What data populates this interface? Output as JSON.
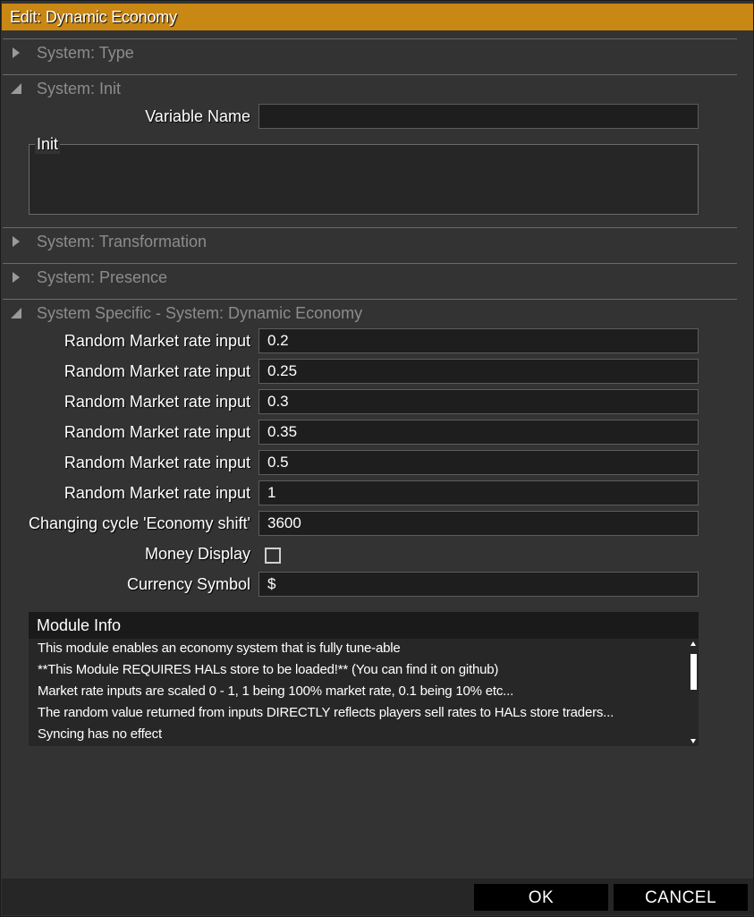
{
  "window": {
    "title": "Edit: Dynamic Economy"
  },
  "sections": {
    "type": {
      "label": "System: Type",
      "expanded": false
    },
    "init": {
      "label": "System: Init",
      "expanded": true
    },
    "transformation": {
      "label": "System: Transformation",
      "expanded": false
    },
    "presence": {
      "label": "System: Presence",
      "expanded": false
    },
    "specific": {
      "label": "System Specific - System: Dynamic Economy",
      "expanded": true
    }
  },
  "init": {
    "variable_name_label": "Variable Name",
    "variable_name_value": "",
    "init_label": "Init",
    "init_value": ""
  },
  "economy": {
    "rates": [
      {
        "label": "Random Market rate input",
        "value": "0.2"
      },
      {
        "label": "Random Market rate input",
        "value": "0.25"
      },
      {
        "label": "Random Market rate input",
        "value": "0.3"
      },
      {
        "label": "Random Market rate input",
        "value": "0.35"
      },
      {
        "label": "Random Market rate input",
        "value": "0.5"
      },
      {
        "label": "Random Market rate input",
        "value": "1"
      }
    ],
    "cycle_label": "Changing cycle 'Economy shift'",
    "cycle_value": "3600",
    "money_display_label": "Money Display",
    "money_display_checked": false,
    "currency_label": "Currency Symbol",
    "currency_value": "$"
  },
  "module_info": {
    "title": "Module Info",
    "lines": [
      "This module enables an economy system that is fully tune-able",
      "**This Module REQUIRES HALs store to be loaded!** (You can find it on github)",
      "Market rate inputs are scaled 0 - 1, 1 being 100% market rate, 0.1 being 10% etc...",
      "The random value returned from inputs DIRECTLY reflects players sell rates to HALs store traders...",
      "Syncing has no effect"
    ]
  },
  "buttons": {
    "ok": "OK",
    "cancel": "CANCEL"
  },
  "colors": {
    "titlebar": "#c98714",
    "background": "#333333",
    "field": "#1e1e1e",
    "section_text": "#8c8c8c"
  }
}
